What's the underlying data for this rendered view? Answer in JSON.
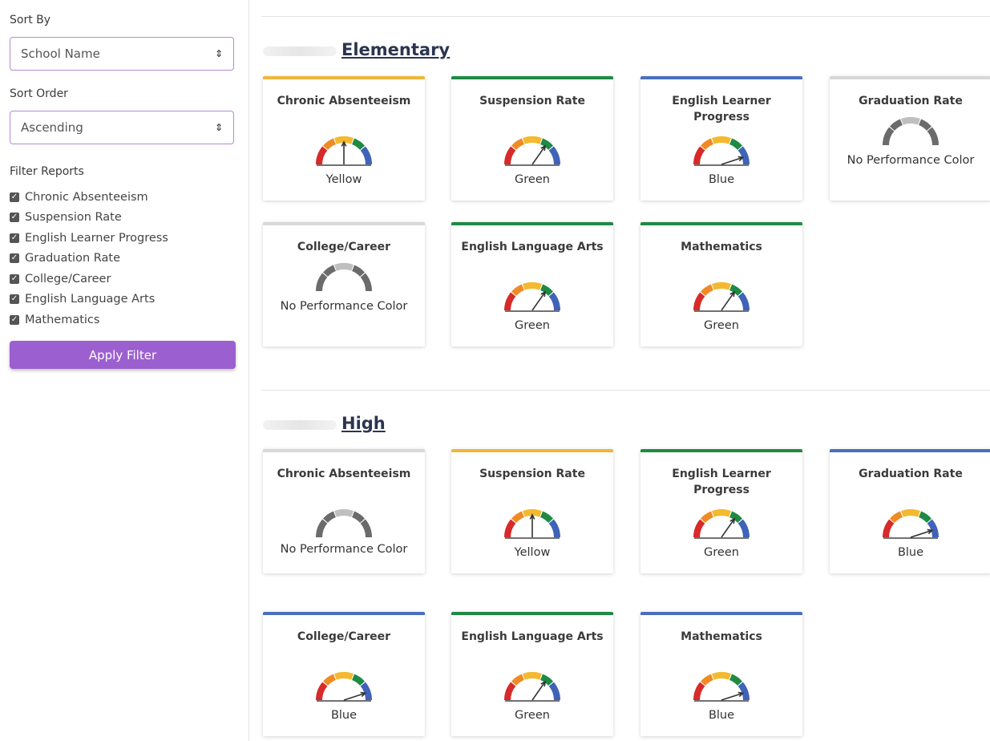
{
  "sidebar": {
    "sort_by_label": "Sort By",
    "sort_by_value": "School Name",
    "sort_order_label": "Sort Order",
    "sort_order_value": "Ascending",
    "filter_label": "Filter Reports",
    "filters": [
      {
        "label": "Chronic Absenteeism",
        "checked": true
      },
      {
        "label": "Suspension Rate",
        "checked": true
      },
      {
        "label": "English Learner Progress",
        "checked": true
      },
      {
        "label": "Graduation Rate",
        "checked": true
      },
      {
        "label": "College/Career",
        "checked": true
      },
      {
        "label": "English Language Arts",
        "checked": true
      },
      {
        "label": "Mathematics",
        "checked": true
      }
    ],
    "apply_label": "Apply Filter"
  },
  "colors": {
    "Yellow": "#f0b63a",
    "Green": "#1e8a44",
    "Blue": "#4a6fbe",
    "None": "#d8d8d8",
    "gauge_red": "#d72a2a",
    "gauge_orange": "#f08a24",
    "gauge_yellow": "#f3b92f",
    "gauge_green": "#1e8a44",
    "gauge_blue": "#3f63b8",
    "gauge_gray_light": "#bfbfbf",
    "gauge_gray_dark": "#6b6b6b"
  },
  "schools": [
    {
      "name": "Elementary",
      "cards": [
        {
          "title": "Chronic Absenteeism",
          "status": "Yellow",
          "level": "Yellow"
        },
        {
          "title": "Suspension Rate",
          "status": "Green",
          "level": "Green"
        },
        {
          "title": "English Learner Progress",
          "status": "Blue",
          "level": "Blue"
        },
        {
          "title": "Graduation Rate",
          "status": "No Performance Color",
          "level": "None"
        },
        {
          "title": "College/Career",
          "status": "No Performance Color",
          "level": "None"
        },
        {
          "title": "English Language Arts",
          "status": "Green",
          "level": "Green"
        },
        {
          "title": "Mathematics",
          "status": "Green",
          "level": "Green"
        }
      ]
    },
    {
      "name": "High",
      "cards": [
        {
          "title": "Chronic Absenteeism",
          "status": "No Performance Color",
          "level": "None"
        },
        {
          "title": "Suspension Rate",
          "status": "Yellow",
          "level": "Yellow"
        },
        {
          "title": "English Learner Progress",
          "status": "Green",
          "level": "Green"
        },
        {
          "title": "Graduation Rate",
          "status": "Blue",
          "level": "Blue"
        },
        {
          "title": "College/Career",
          "status": "Blue",
          "level": "Blue"
        },
        {
          "title": "English Language Arts",
          "status": "Green",
          "level": "Green"
        },
        {
          "title": "Mathematics",
          "status": "Blue",
          "level": "Blue"
        }
      ]
    }
  ]
}
